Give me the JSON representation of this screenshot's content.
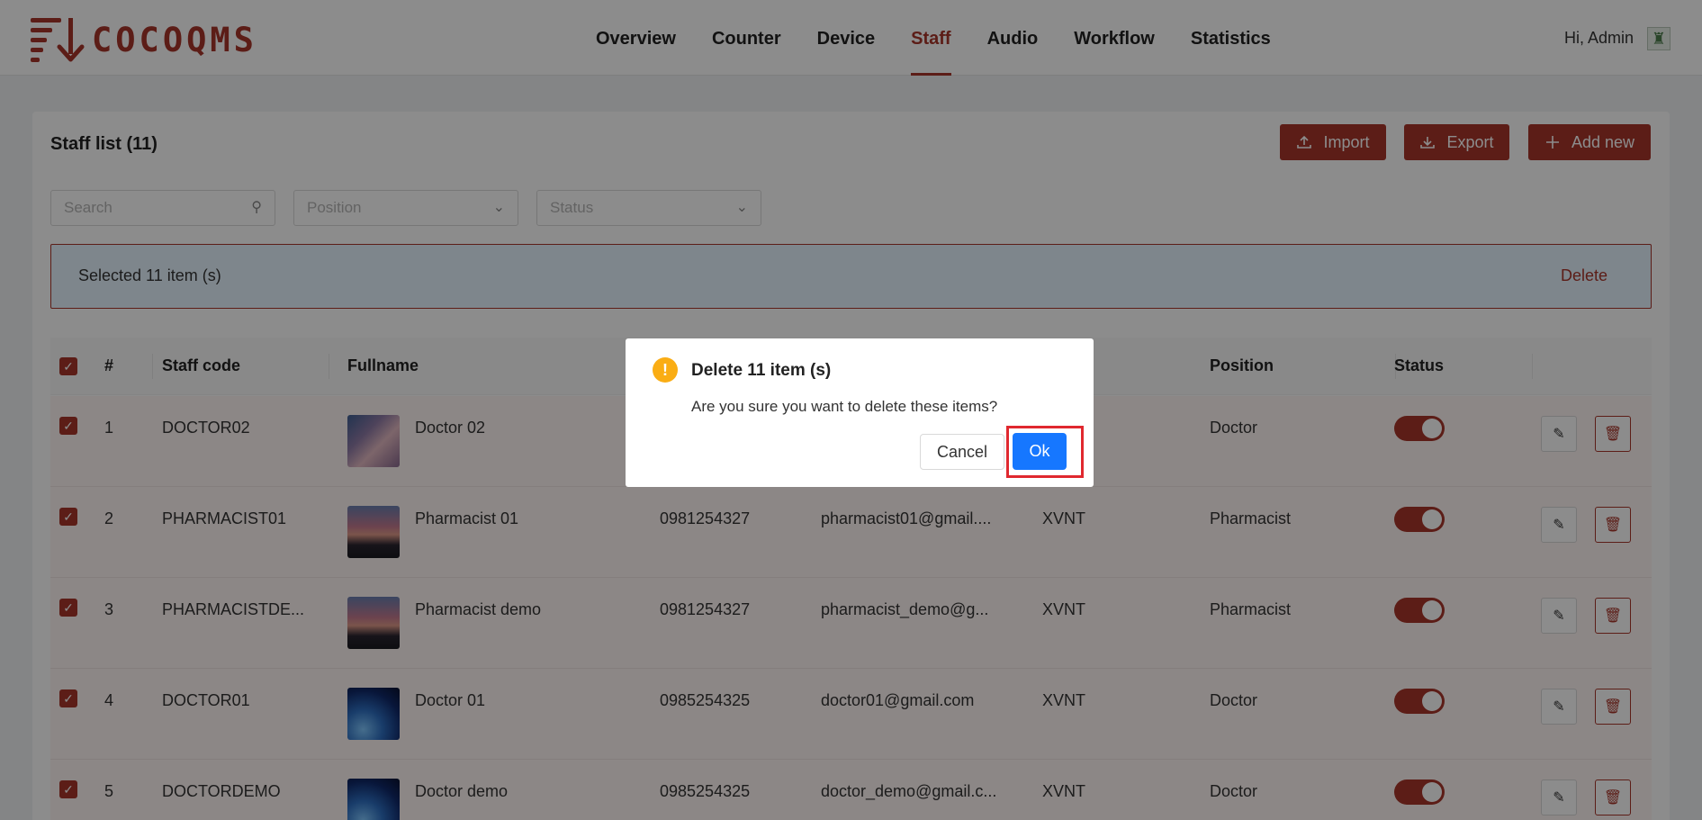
{
  "app": {
    "brand": "COCOQMS",
    "greeting": "Hi, Admin"
  },
  "nav": {
    "items": [
      {
        "label": "Overview"
      },
      {
        "label": "Counter"
      },
      {
        "label": "Device"
      },
      {
        "label": "Staff",
        "active": true
      },
      {
        "label": "Audio"
      },
      {
        "label": "Workflow"
      },
      {
        "label": "Statistics"
      }
    ]
  },
  "staff": {
    "title": "Staff list (11)",
    "import_label": "Import",
    "export_label": "Export",
    "add_label": "Add new",
    "search_placeholder": "Search",
    "position_placeholder": "Position",
    "status_placeholder": "Status",
    "selected_text": "Selected 11 item (s)",
    "delete_label": "Delete"
  },
  "table": {
    "headers": {
      "num": "#",
      "code": "Staff code",
      "name": "Fullname",
      "position": "Position",
      "status": "Status"
    },
    "rows": [
      {
        "num": "1",
        "code": "DOCTOR02",
        "name": "Doctor 02",
        "phone": "",
        "email": "",
        "org": "",
        "position": "Doctor",
        "status": true
      },
      {
        "num": "2",
        "code": "PHARMACIST01",
        "name": "Pharmacist 01",
        "phone": "0981254327",
        "email": "pharmacist01@gmail....",
        "org": "XVNT",
        "position": "Pharmacist",
        "status": true
      },
      {
        "num": "3",
        "code": "PHARMACISTDE...",
        "name": "Pharmacist demo",
        "phone": "0981254327",
        "email": "pharmacist_demo@g...",
        "org": "XVNT",
        "position": "Pharmacist",
        "status": true
      },
      {
        "num": "4",
        "code": "DOCTOR01",
        "name": "Doctor 01",
        "phone": "0985254325",
        "email": "doctor01@gmail.com",
        "org": "XVNT",
        "position": "Doctor",
        "status": true
      },
      {
        "num": "5",
        "code": "DOCTORDEMO",
        "name": "Doctor demo",
        "phone": "0985254325",
        "email": "doctor_demo@gmail.c...",
        "org": "XVNT",
        "position": "Doctor",
        "status": true
      }
    ]
  },
  "modal": {
    "title": "Delete 11 item (s)",
    "text": "Are you sure you want to delete these items?",
    "cancel_label": "Cancel",
    "ok_label": "Ok"
  },
  "colors": {
    "brand": "#a8352a",
    "primary": "#1677ff",
    "warning": "#faad14",
    "highlight": "#e0282f"
  }
}
